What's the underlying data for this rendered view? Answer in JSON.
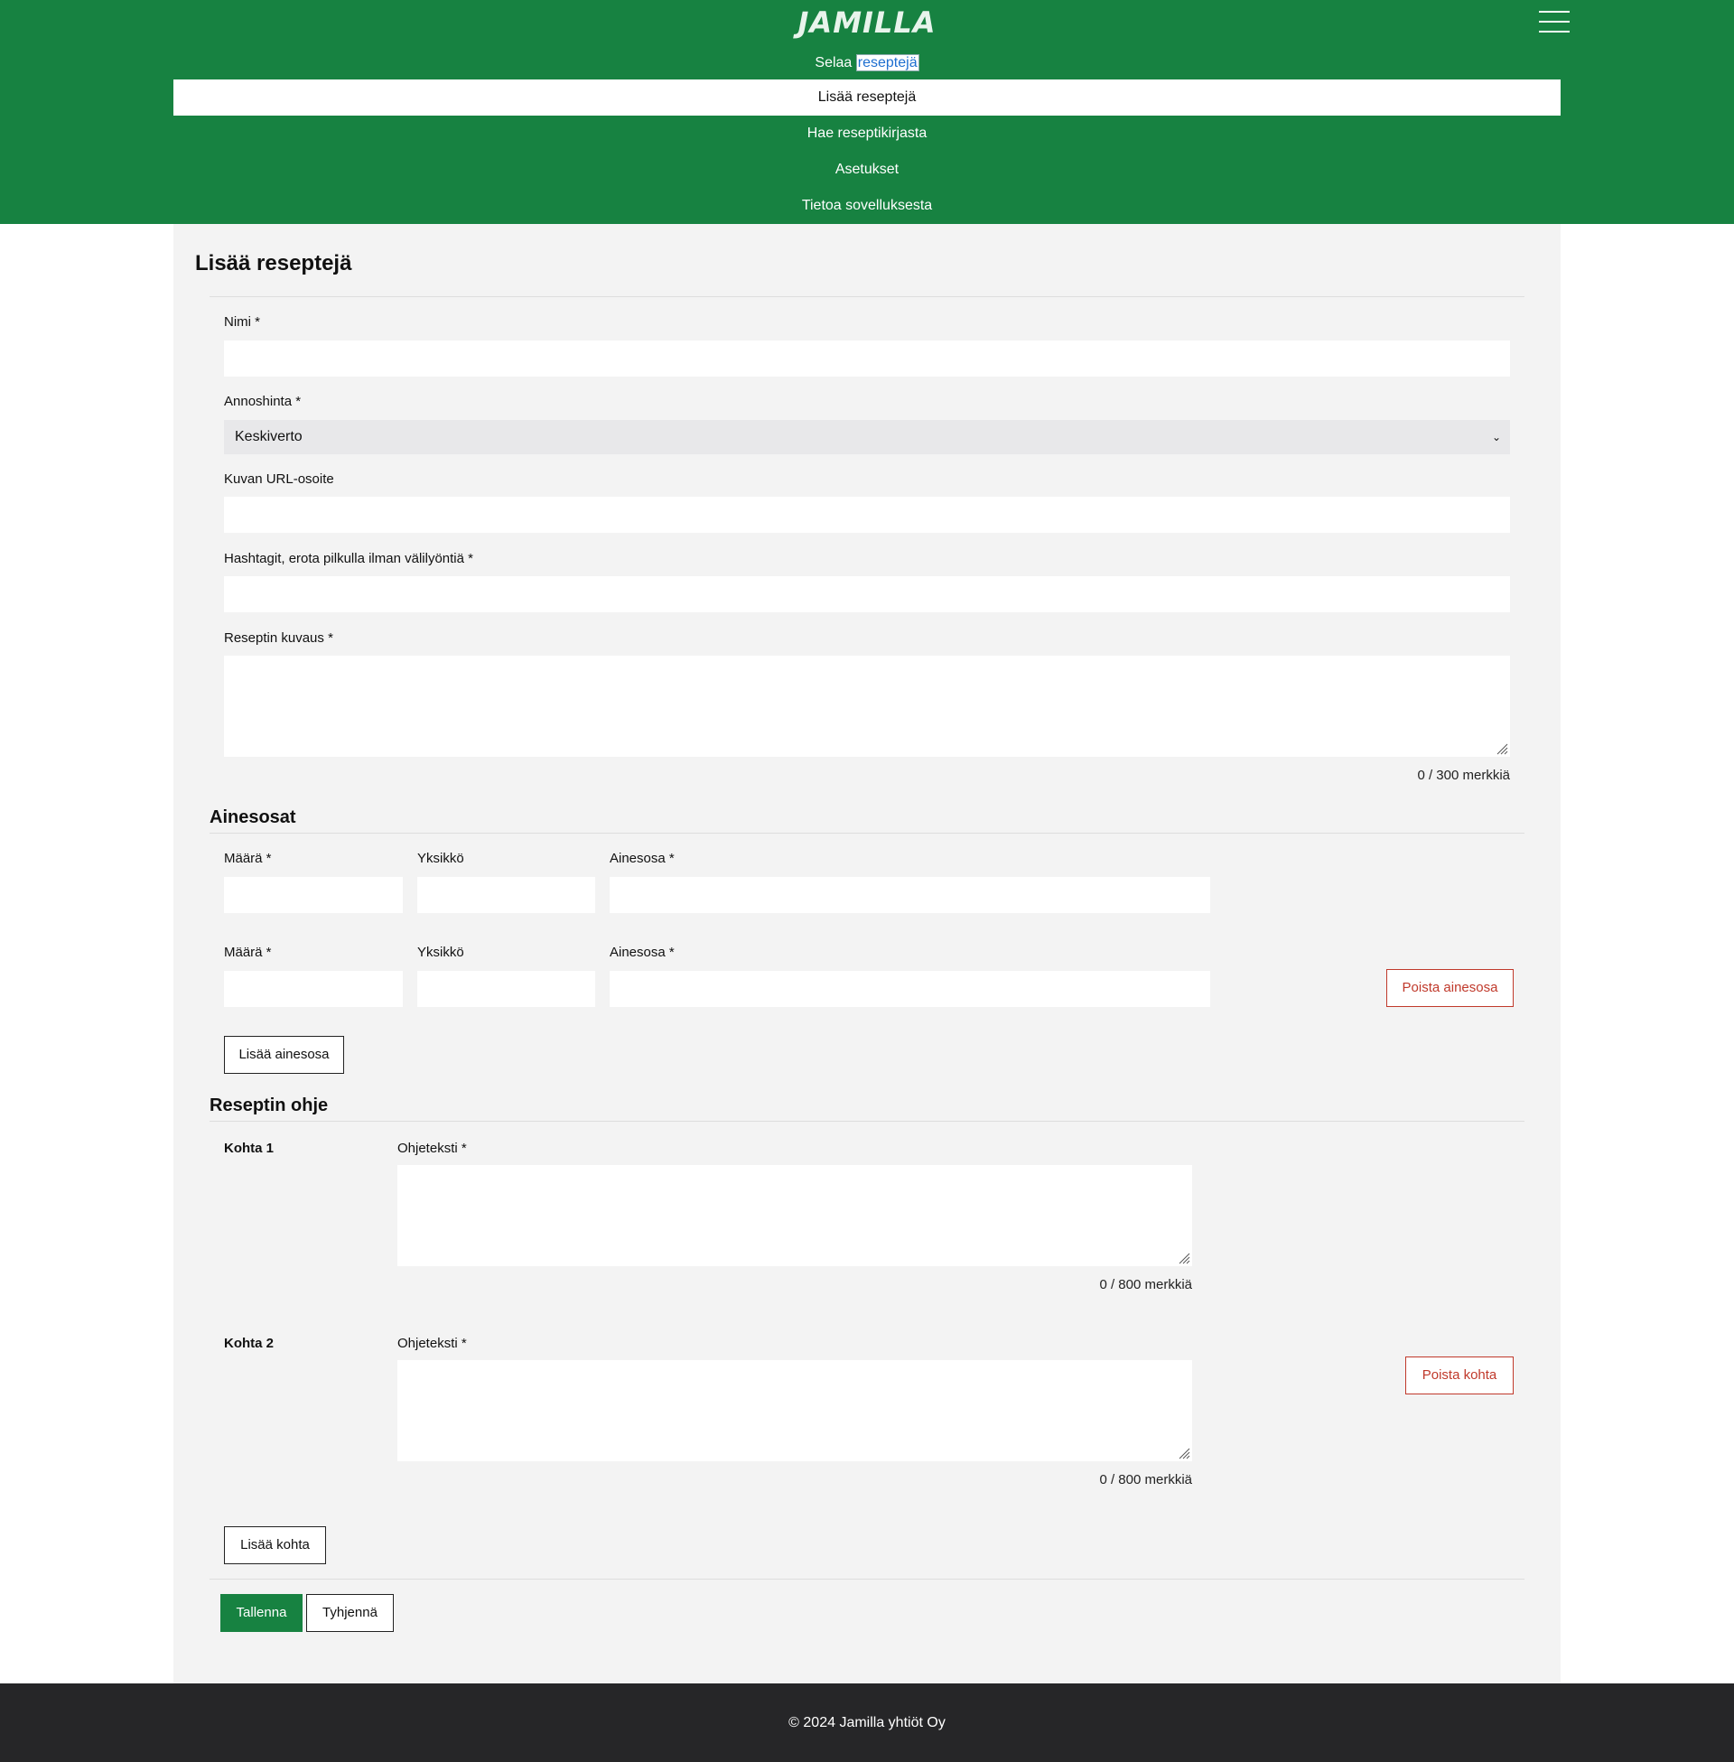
{
  "header": {
    "logo": "JAMILLA",
    "menu_icon": "hamburger-menu-icon",
    "nav": {
      "browse_prefix": "Selaa",
      "browse_highlight": "reseptejä",
      "add": "Lisää reseptejä",
      "search": "Hae reseptikirjasta",
      "settings": "Asetukset",
      "about": "Tietoa sovelluksesta"
    },
    "accent_color": "#178241"
  },
  "form": {
    "title": "Lisää reseptejä",
    "name_label": "Nimi *",
    "name_value": "",
    "portion_label": "Annoshinta *",
    "portion_selected": "Keskiverto",
    "image_label": "Kuvan URL-osoite",
    "image_value": "",
    "hashtags_label": "Hashtagit, erota pilkulla ilman välilyöntiä *",
    "hashtags_value": "",
    "description_label": "Reseptin kuvaus *",
    "description_value": "",
    "description_counter": "0 / 300 merkkiä"
  },
  "ingredients": {
    "title": "Ainesosat",
    "rows": [
      {
        "amount_label": "Määrä *",
        "unit_label": "Yksikkö",
        "ingredient_label": "Ainesosa *"
      },
      {
        "amount_label": "Määrä *",
        "unit_label": "Yksikkö",
        "ingredient_label": "Ainesosa *",
        "remove_label": "Poista ainesosa"
      }
    ],
    "add_label": "Lisää ainesosa"
  },
  "instructions": {
    "title": "Reseptin ohje",
    "steps": [
      {
        "step_label": "Kohta 1",
        "text_label": "Ohjeteksti *",
        "counter": "0 / 800 merkkiä"
      },
      {
        "step_label": "Kohta 2",
        "text_label": "Ohjeteksti *",
        "counter": "0 / 800 merkkiä",
        "remove_label": "Poista kohta"
      }
    ],
    "add_label": "Lisää kohta"
  },
  "actions": {
    "save": "Tallenna",
    "clear": "Tyhjennä"
  },
  "footer": {
    "copyright": "© 2024 Jamilla yhtiöt Oy"
  }
}
